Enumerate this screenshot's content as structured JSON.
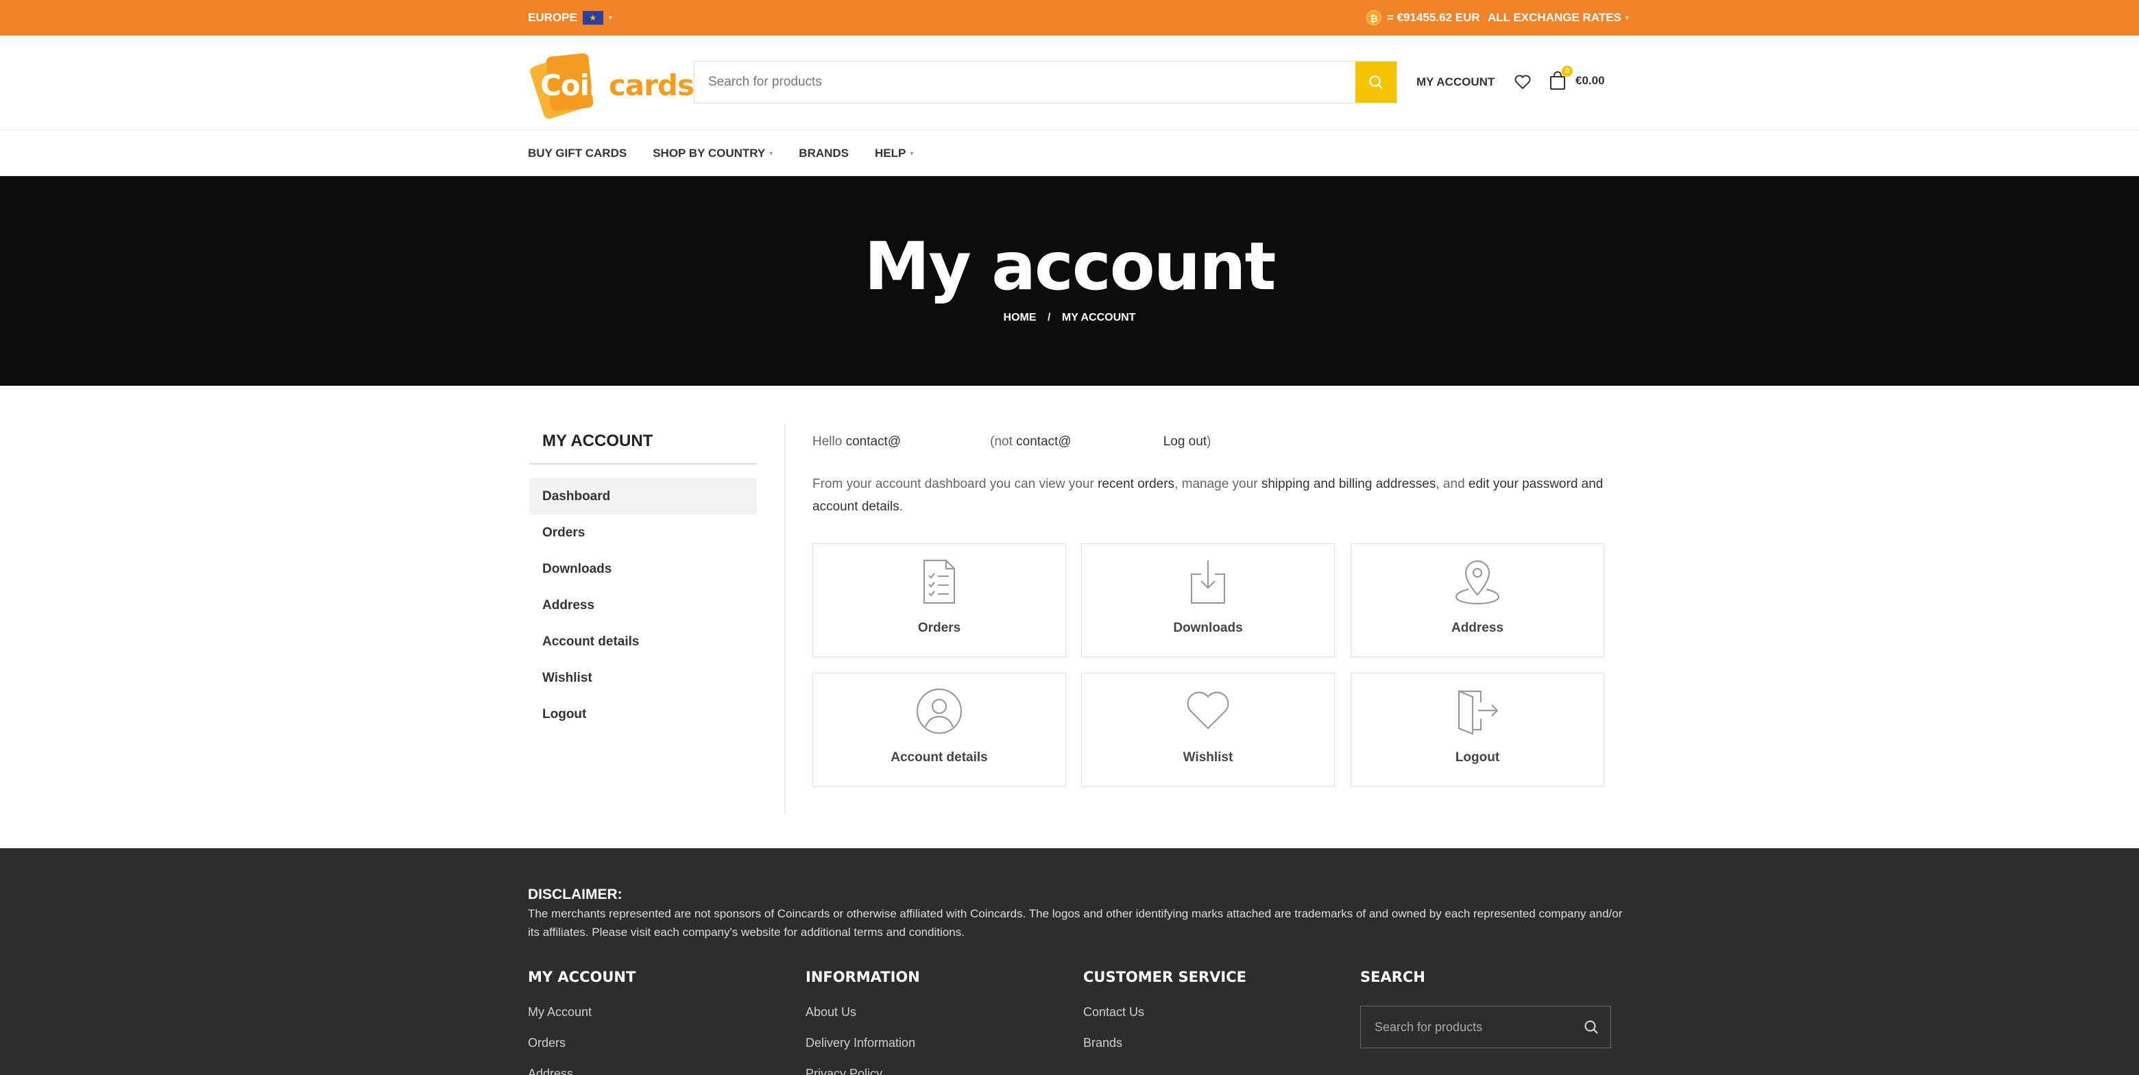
{
  "topbar": {
    "region": "EUROPE",
    "flag_icon": "eu-flag-icon",
    "btc_rate": "= €91455.62 EUR",
    "all_rates": "ALL EXCHANGE RATES"
  },
  "header": {
    "logo": {
      "part1": "Coin",
      "part2": "cards"
    },
    "search_placeholder": "Search for products",
    "my_account": "MY ACCOUNT",
    "cart_count": "0",
    "cart_total": "€0.00"
  },
  "nav": {
    "items": [
      {
        "label": "BUY GIFT CARDS"
      },
      {
        "label": "SHOP BY COUNTRY"
      },
      {
        "label": "BRANDS"
      },
      {
        "label": "HELP"
      }
    ]
  },
  "hero": {
    "title": "My account",
    "breadcrumb_home": "HOME",
    "breadcrumb_sep": "/",
    "breadcrumb_current": "MY ACCOUNT"
  },
  "sidebar": {
    "title": "MY ACCOUNT",
    "items": [
      {
        "label": "Dashboard"
      },
      {
        "label": "Orders"
      },
      {
        "label": "Downloads"
      },
      {
        "label": "Address"
      },
      {
        "label": "Account details"
      },
      {
        "label": "Wishlist"
      },
      {
        "label": "Logout"
      }
    ]
  },
  "content": {
    "hello_prefix": "Hello ",
    "hello_user": "contact@",
    "not_prefix": "(not ",
    "not_user": "contact@",
    "logout_link": "Log out",
    "close_paren": ")",
    "intro_1": "From your account dashboard you can view your ",
    "intro_link_orders": "recent orders",
    "intro_2": ", manage your ",
    "intro_link_addresses": "shipping and billing addresses",
    "intro_3": ", and ",
    "intro_link_password": "edit your password and account details",
    "intro_4": "."
  },
  "tiles": [
    {
      "label": "Orders",
      "icon": "orders-clipboard-icon"
    },
    {
      "label": "Downloads",
      "icon": "download-icon"
    },
    {
      "label": "Address",
      "icon": "map-pin-icon"
    },
    {
      "label": "Account details",
      "icon": "user-icon"
    },
    {
      "label": "Wishlist",
      "icon": "heart-icon"
    },
    {
      "label": "Logout",
      "icon": "logout-door-icon"
    }
  ],
  "footer": {
    "disclaimer_title": "DISCLAIMER:",
    "disclaimer_text": "The merchants represented are not sponsors of Coincards or otherwise affiliated with Coincards. The logos and other identifying marks attached are trademarks of and owned by each represented company and/or its affiliates. Please visit each company's website for additional terms and conditions.",
    "columns": [
      {
        "title": "MY ACCOUNT",
        "links": [
          "My Account",
          "Orders",
          "Address"
        ]
      },
      {
        "title": "INFORMATION",
        "links": [
          "About Us",
          "Delivery Information",
          "Privacy Policy"
        ]
      },
      {
        "title": "CUSTOMER SERVICE",
        "links": [
          "Contact Us",
          "Brands"
        ]
      },
      {
        "title": "SEARCH",
        "links": []
      }
    ],
    "search_placeholder": "Search for products"
  },
  "colors": {
    "topbar": "#f0832a",
    "accent": "#f6c300",
    "hero_bg": "#0c0c0c",
    "footer_bg": "#2d2d2d"
  }
}
